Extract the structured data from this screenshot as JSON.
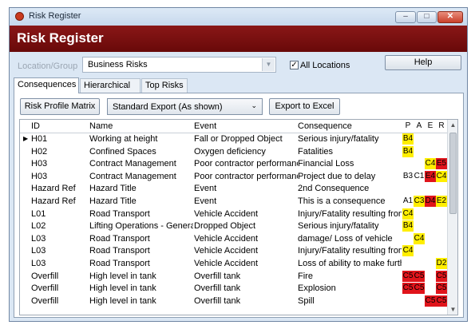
{
  "window": {
    "title": "Risk Register",
    "min": "–",
    "max": "□",
    "close": "✕"
  },
  "banner": {
    "title": "Risk Register"
  },
  "filter": {
    "location_label": "Location/Group",
    "location_value": "Business Risks",
    "all_locations_label": "All Locations",
    "all_locations_checked": true,
    "check_mark": "✓",
    "help_label": "Help"
  },
  "tabs": [
    "Consequences",
    "Hierarchical",
    "Top Risks"
  ],
  "toolbar": {
    "risk_profile_matrix": "Risk Profile Matrix",
    "export_value": "Standard Export (As shown)",
    "export_excel": "Export to Excel",
    "dropdown_glyph": "⌄"
  },
  "grid": {
    "headers": {
      "id": "ID",
      "name": "Name",
      "event": "Event",
      "consequence": "Consequence",
      "p": "P",
      "a": "A",
      "e": "E",
      "r": "R"
    },
    "current_row_marker": "▶",
    "rows": [
      {
        "id": "H01",
        "name": "Working at height",
        "event": "Fall or Dropped Object",
        "consequence": "Serious injury/fatality",
        "ratings": [
          {
            "text": "B4",
            "color": "yellow"
          },
          null,
          null,
          null
        ]
      },
      {
        "id": "H02",
        "name": "Confined Spaces",
        "event": "Oxygen deficiency",
        "consequence": "Fatalities",
        "ratings": [
          {
            "text": "B4",
            "color": "yellow"
          },
          null,
          null,
          null
        ]
      },
      {
        "id": "H03",
        "name": "Contract Management",
        "event": "Poor contractor performance",
        "consequence": "Financial Loss",
        "ratings": [
          null,
          null,
          {
            "text": "C4",
            "color": "yellow"
          },
          {
            "text": "E5",
            "color": "red"
          }
        ]
      },
      {
        "id": "H03",
        "name": "Contract Management",
        "event": "Poor contractor performance",
        "consequence": "Project due to delay",
        "ratings": [
          {
            "text": "B3",
            "color": "none"
          },
          {
            "text": "C1",
            "color": "none"
          },
          {
            "text": "E4",
            "color": "red"
          },
          {
            "text": "C4",
            "color": "yellow"
          }
        ]
      },
      {
        "id": "Hazard Ref",
        "name": "Hazard Title",
        "event": "Event",
        "consequence": "2nd Consequence",
        "ratings": [
          null,
          null,
          null,
          null
        ]
      },
      {
        "id": "Hazard Ref",
        "name": "Hazard Title",
        "event": "Event",
        "consequence": "This is a consequence",
        "ratings": [
          {
            "text": "A1",
            "color": "none"
          },
          {
            "text": "C3",
            "color": "yellow"
          },
          {
            "text": "D4",
            "color": "red"
          },
          {
            "text": "E2",
            "color": "yellow"
          }
        ]
      },
      {
        "id": "L01",
        "name": "Road Transport",
        "event": "Vehicle Accident",
        "consequence": "Injury/Fatality resulting from c",
        "ratings": [
          {
            "text": "C4",
            "color": "yellow"
          },
          null,
          null,
          null
        ]
      },
      {
        "id": "L02",
        "name": "Lifting Operations - General",
        "event": "Dropped Object",
        "consequence": "Serious injury/fatality",
        "ratings": [
          {
            "text": "B4",
            "color": "yellow"
          },
          null,
          null,
          null
        ]
      },
      {
        "id": "L03",
        "name": "Road Transport",
        "event": "Vehicle Accident",
        "consequence": "damage/ Loss of vehicle",
        "ratings": [
          null,
          {
            "text": "C4",
            "color": "yellow"
          },
          null,
          null
        ]
      },
      {
        "id": "L03",
        "name": "Road Transport",
        "event": "Vehicle Accident",
        "consequence": "Injury/Fatality resulting from c",
        "ratings": [
          {
            "text": "C4",
            "color": "yellow"
          },
          null,
          null,
          null
        ]
      },
      {
        "id": "L03",
        "name": "Road Transport",
        "event": "Vehicle Accident",
        "consequence": "Loss of ability to make furthe",
        "ratings": [
          null,
          null,
          null,
          {
            "text": "D2",
            "color": "yellow"
          }
        ]
      },
      {
        "id": "Overfill",
        "name": "High level in tank",
        "event": "Overfill tank",
        "consequence": "Fire",
        "ratings": [
          {
            "text": "C5",
            "color": "red"
          },
          {
            "text": "C5",
            "color": "red"
          },
          null,
          {
            "text": "C5",
            "color": "red"
          }
        ]
      },
      {
        "id": "Overfill",
        "name": "High level in tank",
        "event": "Overfill tank",
        "consequence": "Explosion",
        "ratings": [
          {
            "text": "C5",
            "color": "red"
          },
          {
            "text": "C5",
            "color": "red"
          },
          null,
          {
            "text": "C5",
            "color": "red"
          }
        ]
      },
      {
        "id": "Overfill",
        "name": "High level in tank",
        "event": "Overfill tank",
        "consequence": "Spill",
        "ratings": [
          null,
          null,
          {
            "text": "C5",
            "color": "red"
          },
          {
            "text": "C5",
            "color": "red"
          }
        ]
      }
    ]
  },
  "scrollbar": {
    "up": "▲",
    "down": "▼"
  },
  "colors": {
    "yellow": "#ffee00",
    "red": "#e0141b",
    "banner": "#7b1010"
  }
}
